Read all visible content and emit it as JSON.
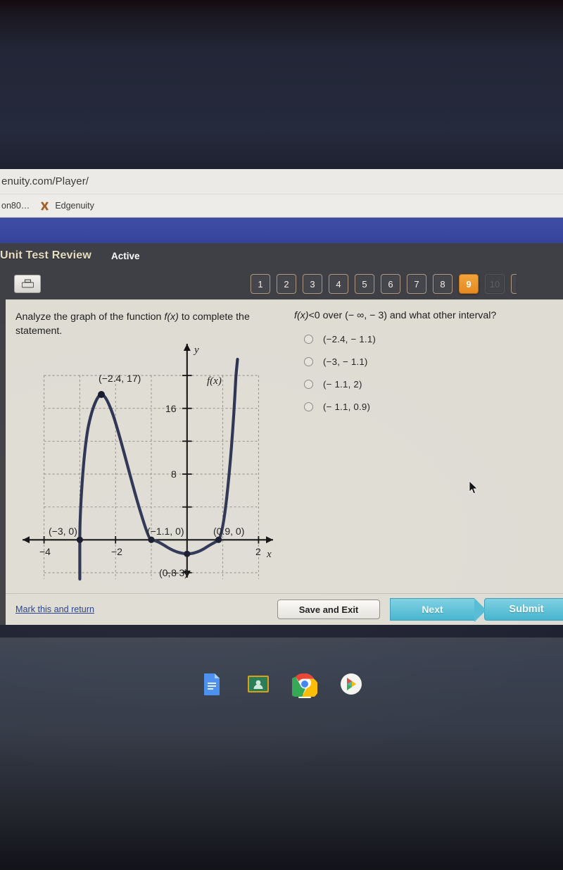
{
  "browser": {
    "url": "enuity.com/Player/",
    "bookmarks": [
      {
        "label": "on80…",
        "icon": "generic-bookmark-icon"
      },
      {
        "label": "Edgenuity",
        "icon": "edgenuity-x-icon"
      }
    ]
  },
  "app": {
    "course_title": "Unit Test Review",
    "status_label": "Active",
    "print_icon": "printer-icon",
    "question_numbers": [
      "1",
      "2",
      "3",
      "4",
      "5",
      "6",
      "7",
      "8",
      "9",
      "10"
    ],
    "active_question": "9",
    "disabled_questions": [
      "10"
    ]
  },
  "question": {
    "prompt_line1": "Analyze the graph of the function ",
    "prompt_fx": "f(x)",
    "prompt_line2": " to complete the statement.",
    "stem_pre": "f(x)",
    "stem_post": "<0 over (− ∞, − 3) and what other interval?",
    "options": [
      {
        "label": "(−2.4, − 1.1)",
        "selected": false
      },
      {
        "label": "(−3, − 1.1)",
        "selected": false
      },
      {
        "label": "(− 1.1, 2)",
        "selected": false
      },
      {
        "label": "(− 1.1, 0.9)",
        "selected": false
      }
    ]
  },
  "footer": {
    "mark_link": "Mark this and return",
    "save_exit_label": "Save and Exit",
    "next_label": "Next",
    "submit_label": "Submit"
  },
  "taskbar": {
    "icons": [
      {
        "name": "google-docs-icon",
        "label": "Docs"
      },
      {
        "name": "google-classroom-icon",
        "label": "Classroom"
      },
      {
        "name": "google-chrome-icon",
        "label": "Chrome"
      },
      {
        "name": "google-play-icon",
        "label": "Play Store"
      }
    ]
  },
  "colors": {
    "accent_orange": "#ef9a2e",
    "chrome_blue": "#3b49a0",
    "app_gray": "#3f4045",
    "panel_bg": "#dedcd3",
    "button_cyan": "#46b5cf",
    "curve_navy": "#2b3352",
    "title_cream": "#e6dcc0"
  },
  "chart_data": {
    "type": "line",
    "title": "",
    "function_label": "f(x)",
    "xlabel": "x",
    "ylabel": "y",
    "xlim": [
      -4.8,
      2.6
    ],
    "ylim": [
      -9.5,
      20.5
    ],
    "xticks": [
      -4,
      -2,
      2
    ],
    "xtick_labels": [
      "−4",
      "−2",
      "2"
    ],
    "yticks": [
      16,
      8,
      -8
    ],
    "ytick_labels": [
      "16",
      "8",
      "−8"
    ],
    "minor_tick_step": 4,
    "grid": true,
    "grid_style": "dashed",
    "grid_x": [
      -4,
      -3,
      -2,
      -1,
      0,
      1,
      2
    ],
    "grid_y": [
      -8,
      -4,
      4,
      8,
      12,
      16,
      20
    ],
    "annotations": [
      {
        "text": "(−3, 0)",
        "x": -3,
        "y": 0,
        "point": true
      },
      {
        "text": "(−2.4, 17)",
        "x": -2.4,
        "y": 17,
        "point": true
      },
      {
        "text": "(−1.1, 0)",
        "x": -1.1,
        "y": 0,
        "point": true
      },
      {
        "text": "(0.9, 0)",
        "x": 0.9,
        "y": 0,
        "point": true
      },
      {
        "text": "(0, −3)",
        "x": 0,
        "y": -3,
        "point": true
      }
    ],
    "roots": [
      -3,
      -1.1,
      0.9
    ],
    "local_max": {
      "x": -2.4,
      "y": 17
    },
    "y_intercept": {
      "x": 0,
      "y": -3
    },
    "series": [
      {
        "name": "f(x)",
        "x": [
          -3.02,
          -3.0,
          -2.9,
          -2.8,
          -2.7,
          -2.6,
          -2.5,
          -2.4,
          -2.3,
          -2.2,
          -2.1,
          -2.0,
          -1.9,
          -1.8,
          -1.7,
          -1.6,
          -1.5,
          -1.4,
          -1.3,
          -1.2,
          -1.1,
          -1.0,
          -0.9,
          -0.8,
          -0.7,
          -0.6,
          -0.5,
          -0.4,
          -0.3,
          -0.2,
          -0.1,
          0.0,
          0.1,
          0.2,
          0.3,
          0.4,
          0.5,
          0.6,
          0.7,
          0.8,
          0.9,
          1.0,
          1.1,
          1.15
        ],
        "y": [
          -9.0,
          0.0,
          10.0,
          15.0,
          16.6,
          17.0,
          17.0,
          17.0,
          16.3,
          15.2,
          13.9,
          12.4,
          10.8,
          9.2,
          7.6,
          6.1,
          4.7,
          3.4,
          2.2,
          1.1,
          0.0,
          -0.9,
          -1.7,
          -2.3,
          -2.7,
          -2.95,
          -3.05,
          -3.1,
          -3.1,
          -3.07,
          -3.03,
          -3.0,
          -2.9,
          -2.7,
          -2.4,
          -2.0,
          -1.5,
          -0.9,
          -0.2,
          0.6,
          0.0,
          6.0,
          14.0,
          20.0
        ]
      }
    ]
  }
}
